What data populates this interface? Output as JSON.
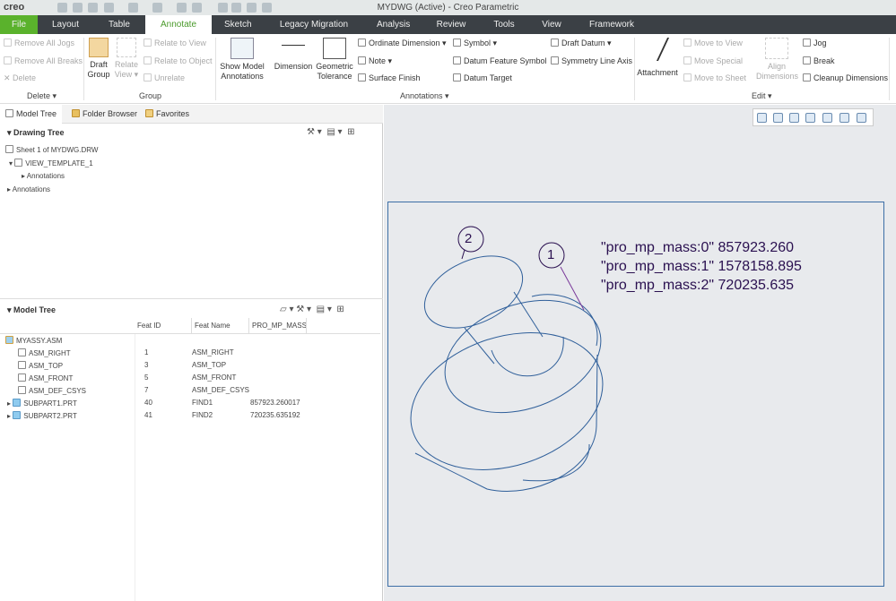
{
  "app": {
    "logo": "creo",
    "title": "MYDWG (Active) - Creo Parametric"
  },
  "tabs": [
    "File",
    "Layout",
    "Table",
    "Annotate",
    "Sketch",
    "Legacy Migration",
    "Analysis",
    "Review",
    "Tools",
    "View",
    "Framework"
  ],
  "active_tab": "Annotate",
  "ribbon": {
    "delete": {
      "items": [
        "Remove All Jogs",
        "Remove All Breaks",
        "Delete"
      ],
      "group": "Delete"
    },
    "group": {
      "draft_group": "Draft Group",
      "relate_view": "Relate View",
      "items": [
        "Relate to View",
        "Relate to Object",
        "Unrelate"
      ],
      "group": "Group"
    },
    "annotations": {
      "show_model": "Show Model Annotations",
      "dimension": "Dimension",
      "geom_tol": "Geometric Tolerance",
      "col1": [
        "Ordinate Dimension",
        "Note",
        "Surface Finish"
      ],
      "col2": [
        "Symbol",
        "Datum Feature Symbol",
        "Datum Target"
      ],
      "col3": [
        "Draft Datum",
        "Symmetry Line Axis"
      ],
      "group": "Annotations"
    },
    "edit": {
      "attachment": "Attachment",
      "moves": [
        "Move to View",
        "Move Special",
        "Move to Sheet"
      ],
      "align": "Align Dimensions",
      "items": [
        "Jog",
        "Break",
        "Cleanup Dimensions"
      ],
      "group": "Edit"
    }
  },
  "panel_tabs": [
    "Model Tree",
    "Folder Browser",
    "Favorites"
  ],
  "drawing_tree": {
    "title": "Drawing Tree",
    "items": [
      "Sheet 1 of MYDWG.DRW",
      "VIEW_TEMPLATE_1",
      "Annotations",
      "Annotations"
    ]
  },
  "model_tree": {
    "title": "Model Tree",
    "columns": [
      "Feat ID",
      "Feat Name",
      "PRO_MP_MASS"
    ],
    "root": "MYASSY.ASM",
    "rows": [
      {
        "name": "ASM_RIGHT",
        "id": "1",
        "feat": "ASM_RIGHT",
        "mass": ""
      },
      {
        "name": "ASM_TOP",
        "id": "3",
        "feat": "ASM_TOP",
        "mass": ""
      },
      {
        "name": "ASM_FRONT",
        "id": "5",
        "feat": "ASM_FRONT",
        "mass": ""
      },
      {
        "name": "ASM_DEF_CSYS",
        "id": "7",
        "feat": "ASM_DEF_CSYS",
        "mass": ""
      },
      {
        "name": "SUBPART1.PRT",
        "id": "40",
        "feat": "FIND1",
        "mass": "857923.260017"
      },
      {
        "name": "SUBPART2.PRT",
        "id": "41",
        "feat": "FIND2",
        "mass": "720235.635192"
      }
    ]
  },
  "drawing": {
    "balloons": [
      "2",
      "1"
    ],
    "params": [
      "\"pro_mp_mass:0\" 857923.260",
      "\"pro_mp_mass:1\" 1578158.895",
      "\"pro_mp_mass:2\" 720235.635"
    ]
  },
  "colors": {
    "accent": "#5ab22c",
    "tabbar": "#3b4045",
    "sheet_border": "#3c6ea6",
    "geometry": "#2f5f9a"
  }
}
